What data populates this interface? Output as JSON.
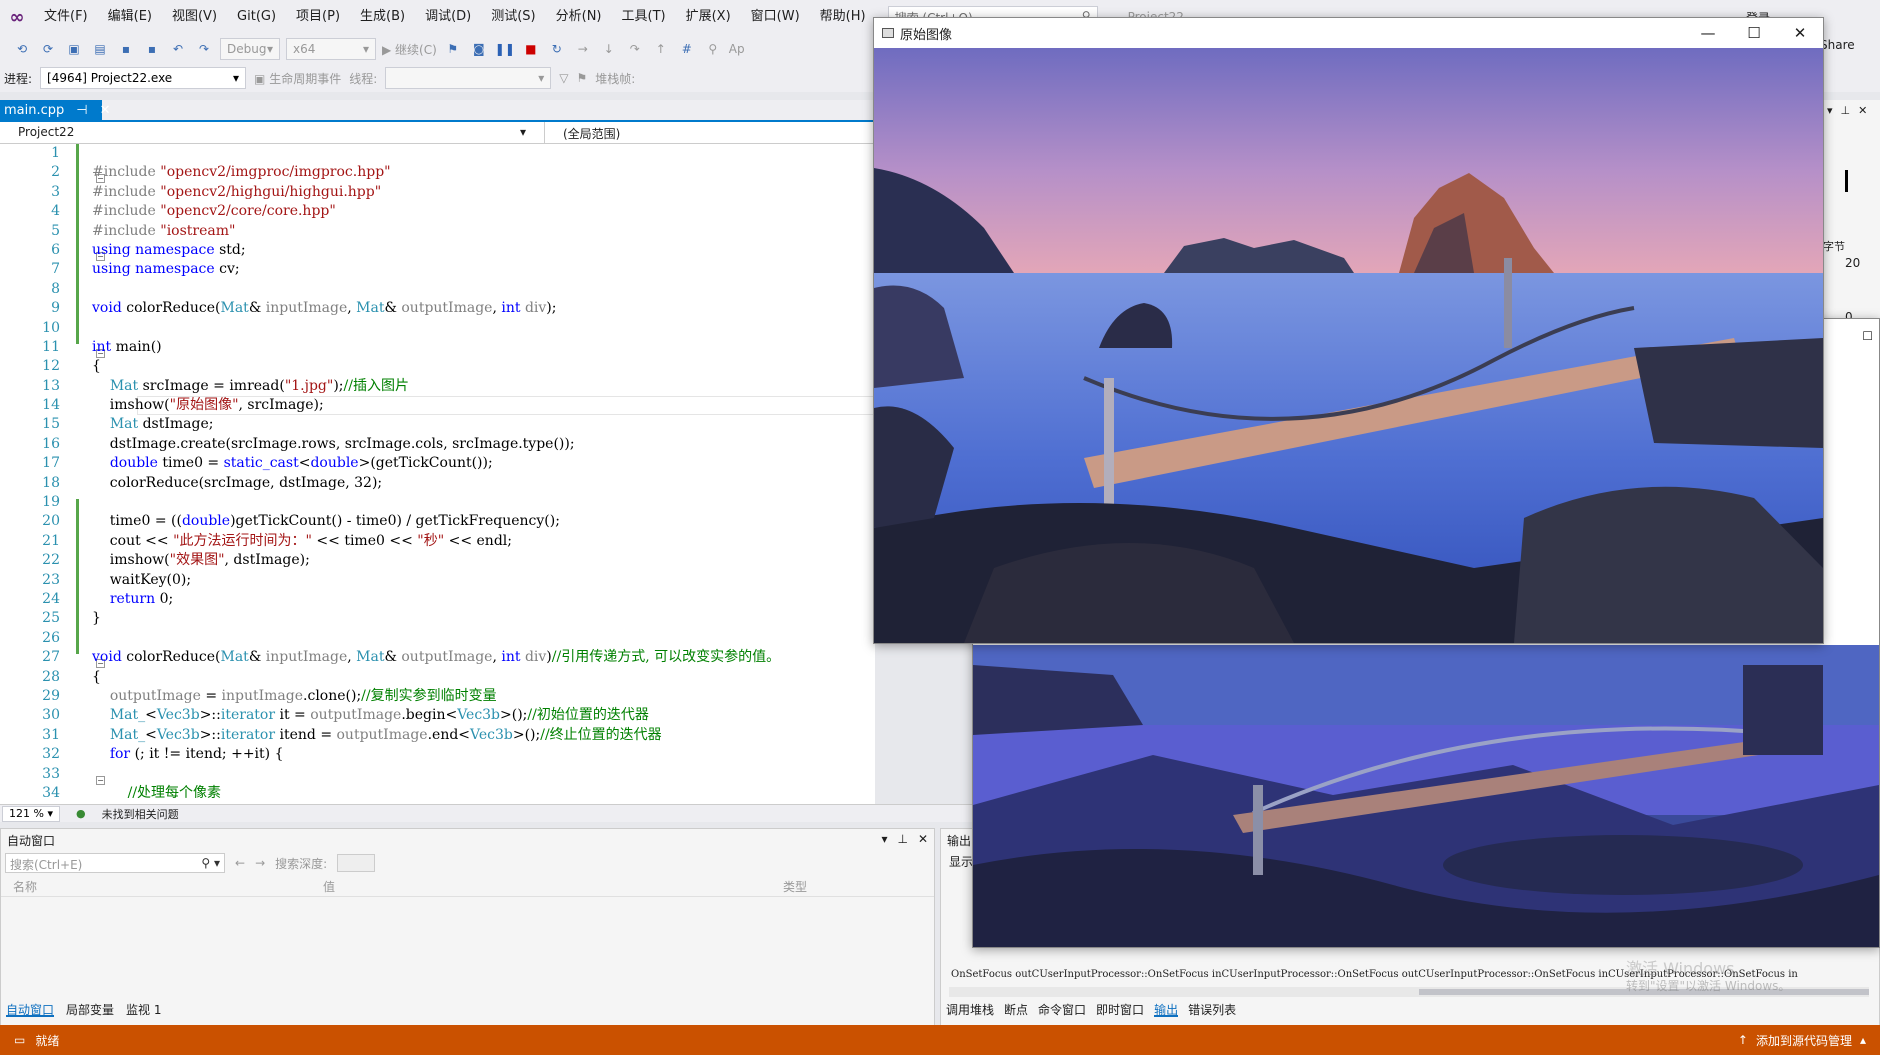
{
  "menubar": {
    "items": [
      "文件(F)",
      "编辑(E)",
      "视图(V)",
      "Git(G)",
      "项目(P)",
      "生成(B)",
      "调试(D)",
      "测试(S)",
      "分析(N)",
      "工具(T)",
      "扩展(X)",
      "窗口(W)",
      "帮助(H)"
    ],
    "search_placeholder": "搜索 (Ctrl+Q)",
    "project_title": "Project22",
    "login": "登录",
    "share": "Share"
  },
  "toolbar1": {
    "config": "Debug",
    "platform": "x64",
    "continue": "继续(C)",
    "app": "Ap"
  },
  "toolbar2": {
    "process_label": "进程:",
    "process_value": "[4964] Project22.exe",
    "lifecycle": "生命周期事件",
    "thread_label": "线程:",
    "stackframe_label": "堆栈帧:"
  },
  "tabs": {
    "active": "main.cpp"
  },
  "navbar": {
    "project": "Project22",
    "scope": "(全局范围)"
  },
  "editor": {
    "line_numbers": [
      "1",
      "2",
      "3",
      "4",
      "5",
      "6",
      "7",
      "8",
      "9",
      "10",
      "11",
      "12",
      "13",
      "14",
      "15",
      "16",
      "17",
      "18",
      "19",
      "20",
      "21",
      "22",
      "23",
      "24",
      "25",
      "26",
      "27",
      "28",
      "29",
      "30",
      "31",
      "32",
      "33",
      "34"
    ],
    "lines": [
      "",
      "#include \"opencv2/imgproc/imgproc.hpp\"",
      "#include \"opencv2/highgui/highgui.hpp\"",
      "#include \"opencv2/core/core.hpp\"",
      "#include \"iostream\"",
      "using namespace std;",
      "using namespace cv;",
      "",
      "void colorReduce(Mat& inputImage, Mat& outputImage, int div);",
      "",
      "int main()",
      "{",
      "    Mat srcImage = imread(\"1.jpg\");//插入图片",
      "    imshow(\"原始图像\", srcImage);",
      "    Mat dstImage;",
      "    dstImage.create(srcImage.rows, srcImage.cols, srcImage.type());",
      "    double time0 = static_cast<double>(getTickCount());",
      "    colorReduce(srcImage, dstImage, 32);",
      "",
      "    time0 = ((double)getTickCount() - time0) / getTickFrequency();",
      "    cout << \"此方法运行时间为：\" << time0 << \"秒\" << endl;",
      "    imshow(\"效果图\", dstImage);",
      "    waitKey(0);",
      "    return 0;",
      "}",
      "",
      "void colorReduce(Mat& inputImage, Mat& outputImage, int div)//引用传递方式, 可以改变实参的值。",
      "{",
      "    outputImage = inputImage.clone();//复制实参到临时变量",
      "    Mat_<Vec3b>::iterator it = outputImage.begin<Vec3b>();//初始位置的迭代器",
      "    Mat_<Vec3b>::iterator itend = outputImage.end<Vec3b>();//终止位置的迭代器",
      "    for (; it != itend; ++it) {",
      "",
      "        //处理每个像素"
    ]
  },
  "editor_status": {
    "zoom": "121 %",
    "issues": "未找到相关问题"
  },
  "autos": {
    "title": "自动窗口",
    "search_placeholder": "搜索(Ctrl+E)",
    "depth_label": "搜索深度:",
    "col_name": "名称",
    "col_value": "值",
    "col_type": "类型",
    "tabs": [
      "自动窗口",
      "局部变量",
      "监视 1"
    ]
  },
  "output": {
    "title": "输出",
    "show_label": "显示",
    "text": "OnSetFocus outCUserInputProcessor::OnSetFocus inCUserInputProcessor::OnSetFocus outCUserInputProcessor::OnSetFocus inCUserInputProcessor::OnSetFocus in",
    "watermark1": "激活 Windows",
    "watermark2": "转到\"设置\"以激活 Windows。",
    "tabs": [
      "调用堆栈",
      "断点",
      "命令窗口",
      "即时窗口",
      "输出",
      "错误列表"
    ]
  },
  "right_panel": {
    "label": "字节",
    "value1": "20",
    "value2": "0"
  },
  "statusbar": {
    "left": "就绪",
    "right": "添加到源代码管理"
  },
  "image_window": {
    "title": "原始图像"
  },
  "colors": {
    "accent": "#007acc",
    "status": "#ca5100"
  }
}
